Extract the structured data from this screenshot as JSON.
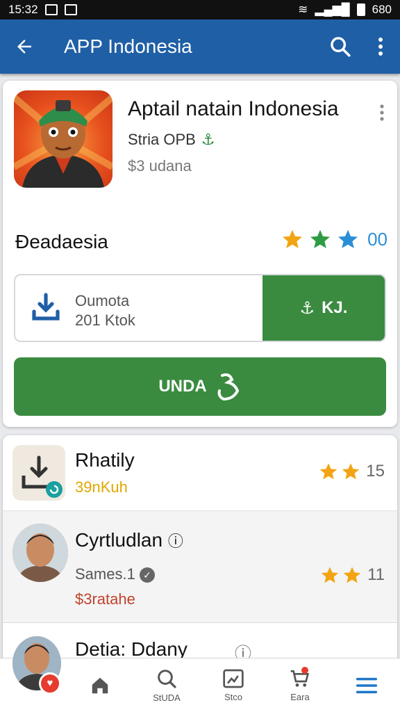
{
  "status": {
    "time": "15:32",
    "right": "680"
  },
  "appbar": {
    "title": "APP Indonesia"
  },
  "app": {
    "title": "Aptail natain Indonesia",
    "developer": "Stria OPB",
    "price": "$3 udana"
  },
  "section": {
    "title": "Ðeadaesia",
    "rating_value": "00",
    "star_colors": [
      "#f2a413",
      "#2f9b44",
      "#2b8fd8"
    ]
  },
  "download": {
    "line1": "Oumota",
    "line2": "201 Ktok",
    "button": "KJ."
  },
  "install_button": "UNDA",
  "list": [
    {
      "name": "Rhatily",
      "sub": "39nKuh",
      "sub_color": "#e0a800",
      "rating": "15"
    },
    {
      "name": "Cyrtludlan",
      "sub": "Sames.1",
      "sub2": "$3ratahe",
      "sub2_color": "#c0432a",
      "rating": "11"
    },
    {
      "name": "Detia: Ddany"
    }
  ],
  "bottomnav": [
    {
      "label": "",
      "icon": "profile-icon"
    },
    {
      "label": "",
      "icon": "home-icon"
    },
    {
      "label": "StUDA",
      "icon": "search-icon"
    },
    {
      "label": "Stco",
      "icon": "store-icon"
    },
    {
      "label": "Eara",
      "icon": "cart-icon"
    },
    {
      "label": "",
      "icon": "menu-icon"
    }
  ]
}
